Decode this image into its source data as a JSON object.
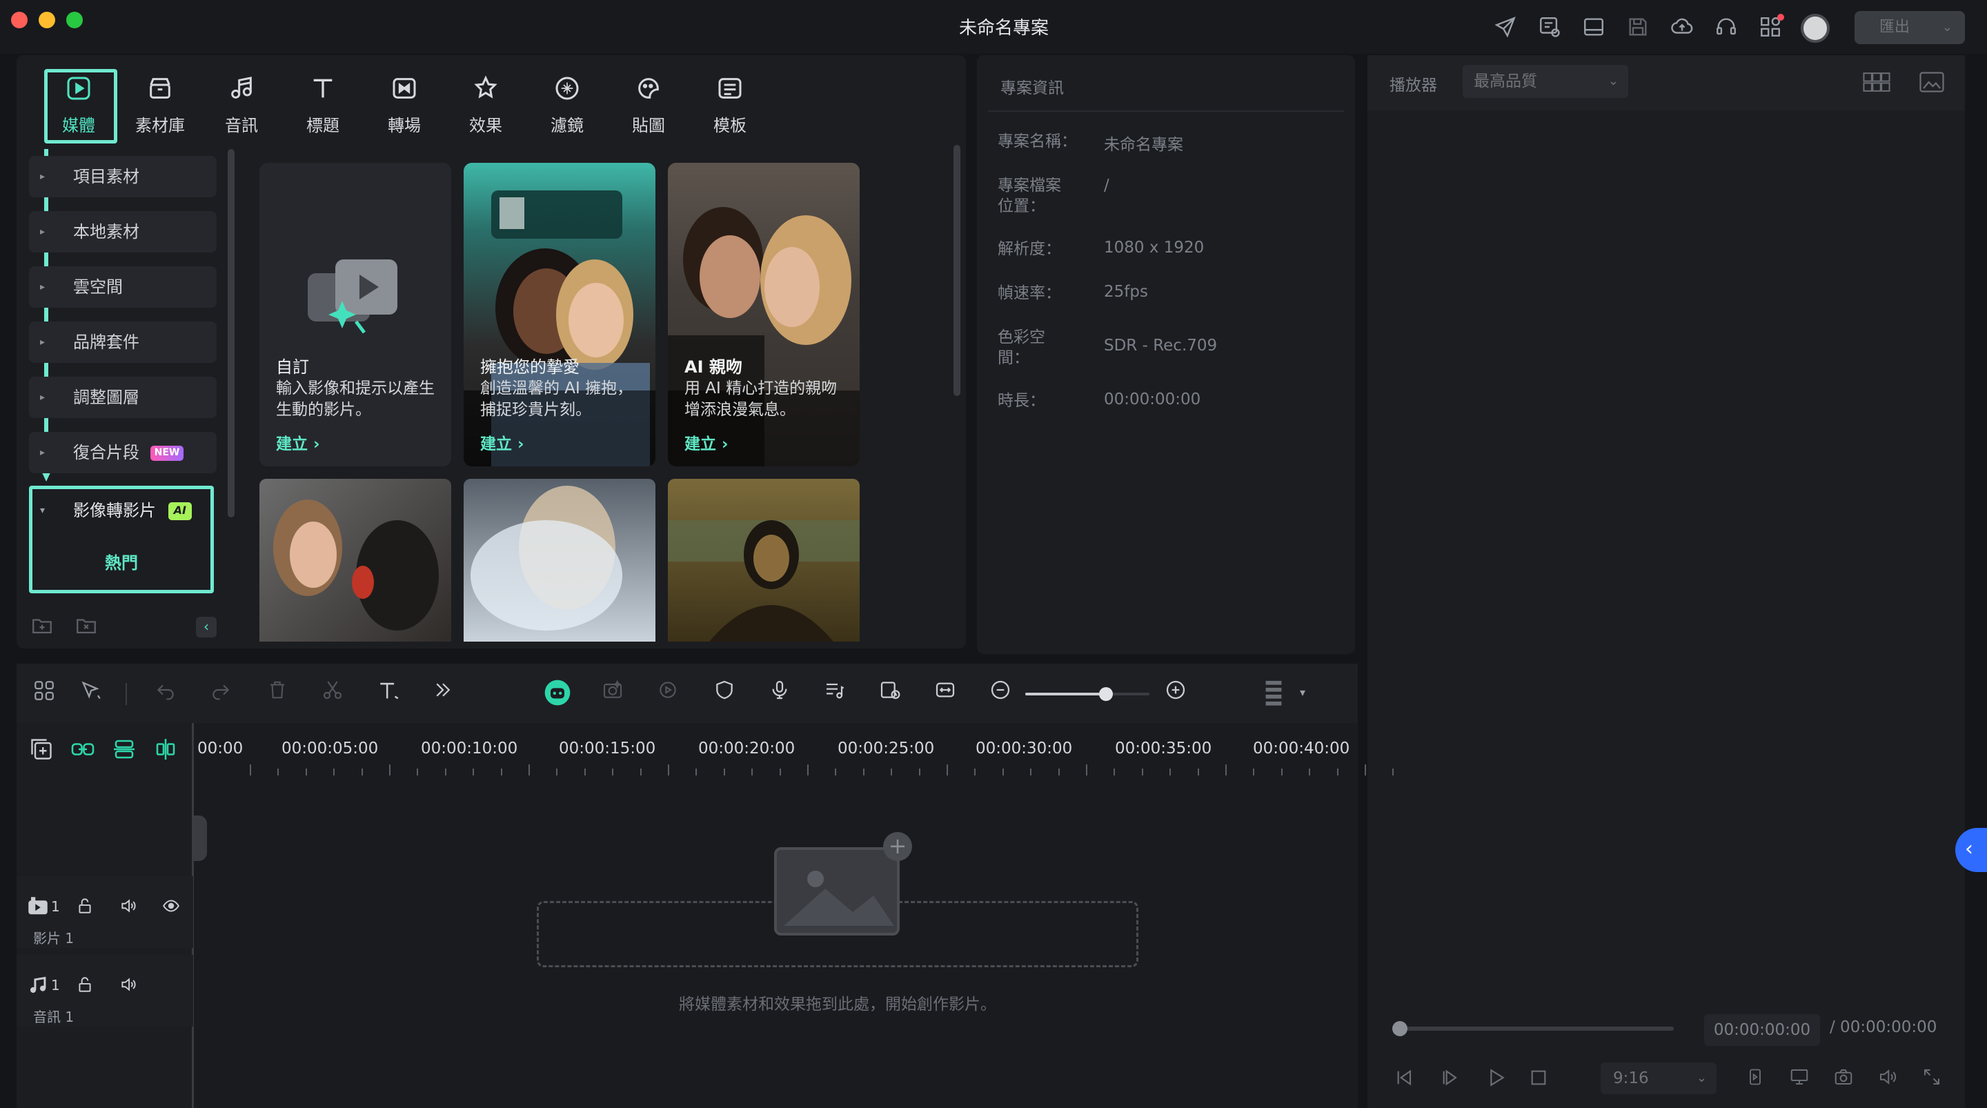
{
  "window": {
    "title": "未命名專案",
    "traffic_lights": [
      "#ff5f57",
      "#febc2e",
      "#28c840"
    ],
    "export_label": "匯出",
    "toolbar_icons": [
      "send-icon",
      "task-list-icon",
      "layout-icon",
      "save-icon",
      "cloud-upload-icon",
      "headset-icon",
      "apps-icon"
    ]
  },
  "media_tabs": [
    {
      "label": "媒體",
      "icon": "media-icon",
      "active": true
    },
    {
      "label": "素材庫",
      "icon": "stock-icon"
    },
    {
      "label": "音訊",
      "icon": "music-note-icon"
    },
    {
      "label": "標題",
      "icon": "text-t-icon"
    },
    {
      "label": "轉場",
      "icon": "transition-icon"
    },
    {
      "label": "效果",
      "icon": "effects-icon"
    },
    {
      "label": "濾鏡",
      "icon": "filter-icon"
    },
    {
      "label": "貼圖",
      "icon": "sticker-icon"
    },
    {
      "label": "模板",
      "icon": "template-icon"
    }
  ],
  "sidebar": {
    "items": [
      {
        "label": "項目素材"
      },
      {
        "label": "本地素材"
      },
      {
        "label": "雲空間"
      },
      {
        "label": "品牌套件"
      },
      {
        "label": "調整圖層"
      },
      {
        "label": "復合片段",
        "badge": "NEW"
      }
    ],
    "expanded": {
      "label": "影像轉影片",
      "badge": "AI",
      "child": "熱門"
    }
  },
  "cards": [
    {
      "title": "自訂",
      "desc": "輸入影像和提示以產生生動的影片。",
      "link": "建立"
    },
    {
      "title": "擁抱您的摯愛",
      "desc": "創造溫馨的 AI 擁抱，捕捉珍貴片刻。",
      "link": "建立"
    },
    {
      "title": "AI 親吻",
      "desc": "用 AI 精心打造的親吻增添浪漫氣息。",
      "link": "建立"
    }
  ],
  "project_info": {
    "header": "專案資訊",
    "rows": [
      {
        "label": "專案名稱：",
        "value": "未命名專案"
      },
      {
        "label": "專案檔案\n位置：",
        "value": "/"
      },
      {
        "label": "解析度：",
        "value": "1080 x 1920"
      },
      {
        "label": "幀速率：",
        "value": "25fps"
      },
      {
        "label": "色彩空\n間：",
        "value": "SDR - Rec.709"
      },
      {
        "label": "時長：",
        "value": "00:00:00:00"
      }
    ]
  },
  "player": {
    "label": "播放器",
    "quality": "最高品質",
    "current_time": "00:00:00:00",
    "total_time": "/ 00:00:00:00",
    "aspect": "9:16",
    "progress": 0
  },
  "timeline": {
    "ruler": [
      "00:00",
      "00:00:05:00",
      "00:00:10:00",
      "00:00:15:00",
      "00:00:20:00",
      "00:00:25:00",
      "00:00:30:00",
      "00:00:35:00",
      "00:00:40:00"
    ],
    "tracks": [
      {
        "label": "影片 1",
        "num": "1"
      },
      {
        "label": "音訊 1",
        "num": "1"
      }
    ],
    "drop_hint": "將媒體素材和效果拖到此處，開始創作影片。",
    "zoom_level": 0.65
  }
}
